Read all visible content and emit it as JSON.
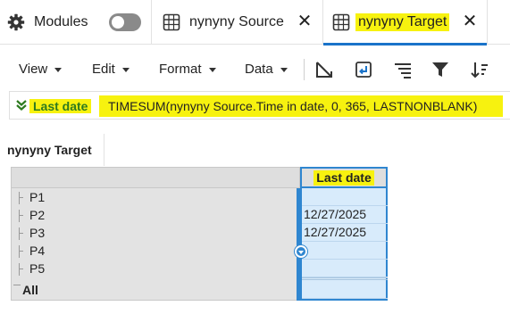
{
  "tabs": {
    "modules_label": "Modules",
    "source_label": "nynyny Source",
    "target_label": "nynyny Target",
    "close_glyph": "✕"
  },
  "toolbar": {
    "menus": [
      "View",
      "Edit",
      "Format",
      "Data"
    ]
  },
  "formula_bar": {
    "line_item": "Last date",
    "formula": "TIMESUM(nynyny Source.Time in date, 0, 365, LASTNONBLANK)"
  },
  "view": {
    "title": "nynyny Target"
  },
  "grid": {
    "column_header": "Last date",
    "rows": [
      {
        "label": "P1",
        "value": ""
      },
      {
        "label": "P2",
        "value": "12/27/2025"
      },
      {
        "label": "P3",
        "value": "12/27/2025"
      },
      {
        "label": "P4",
        "value": ""
      },
      {
        "label": "P5",
        "value": ""
      }
    ],
    "total_label": "All",
    "total_value": ""
  },
  "colors": {
    "highlight": "#f7f20f",
    "selection": "#2f86d0",
    "selected_cells": "#d8ebfb",
    "line_item_green": "#2d7a1f",
    "toggle_off": "#8a8a8a"
  },
  "icons": {
    "modules": "gear-icon",
    "tab": "grid-table-icon",
    "close": "close-icon",
    "toolbar": [
      "pivot-icon",
      "insert-icon",
      "sort-lines-icon",
      "filter-icon",
      "sort-icon"
    ],
    "formula_toggle": "double-chevron-down-icon"
  }
}
